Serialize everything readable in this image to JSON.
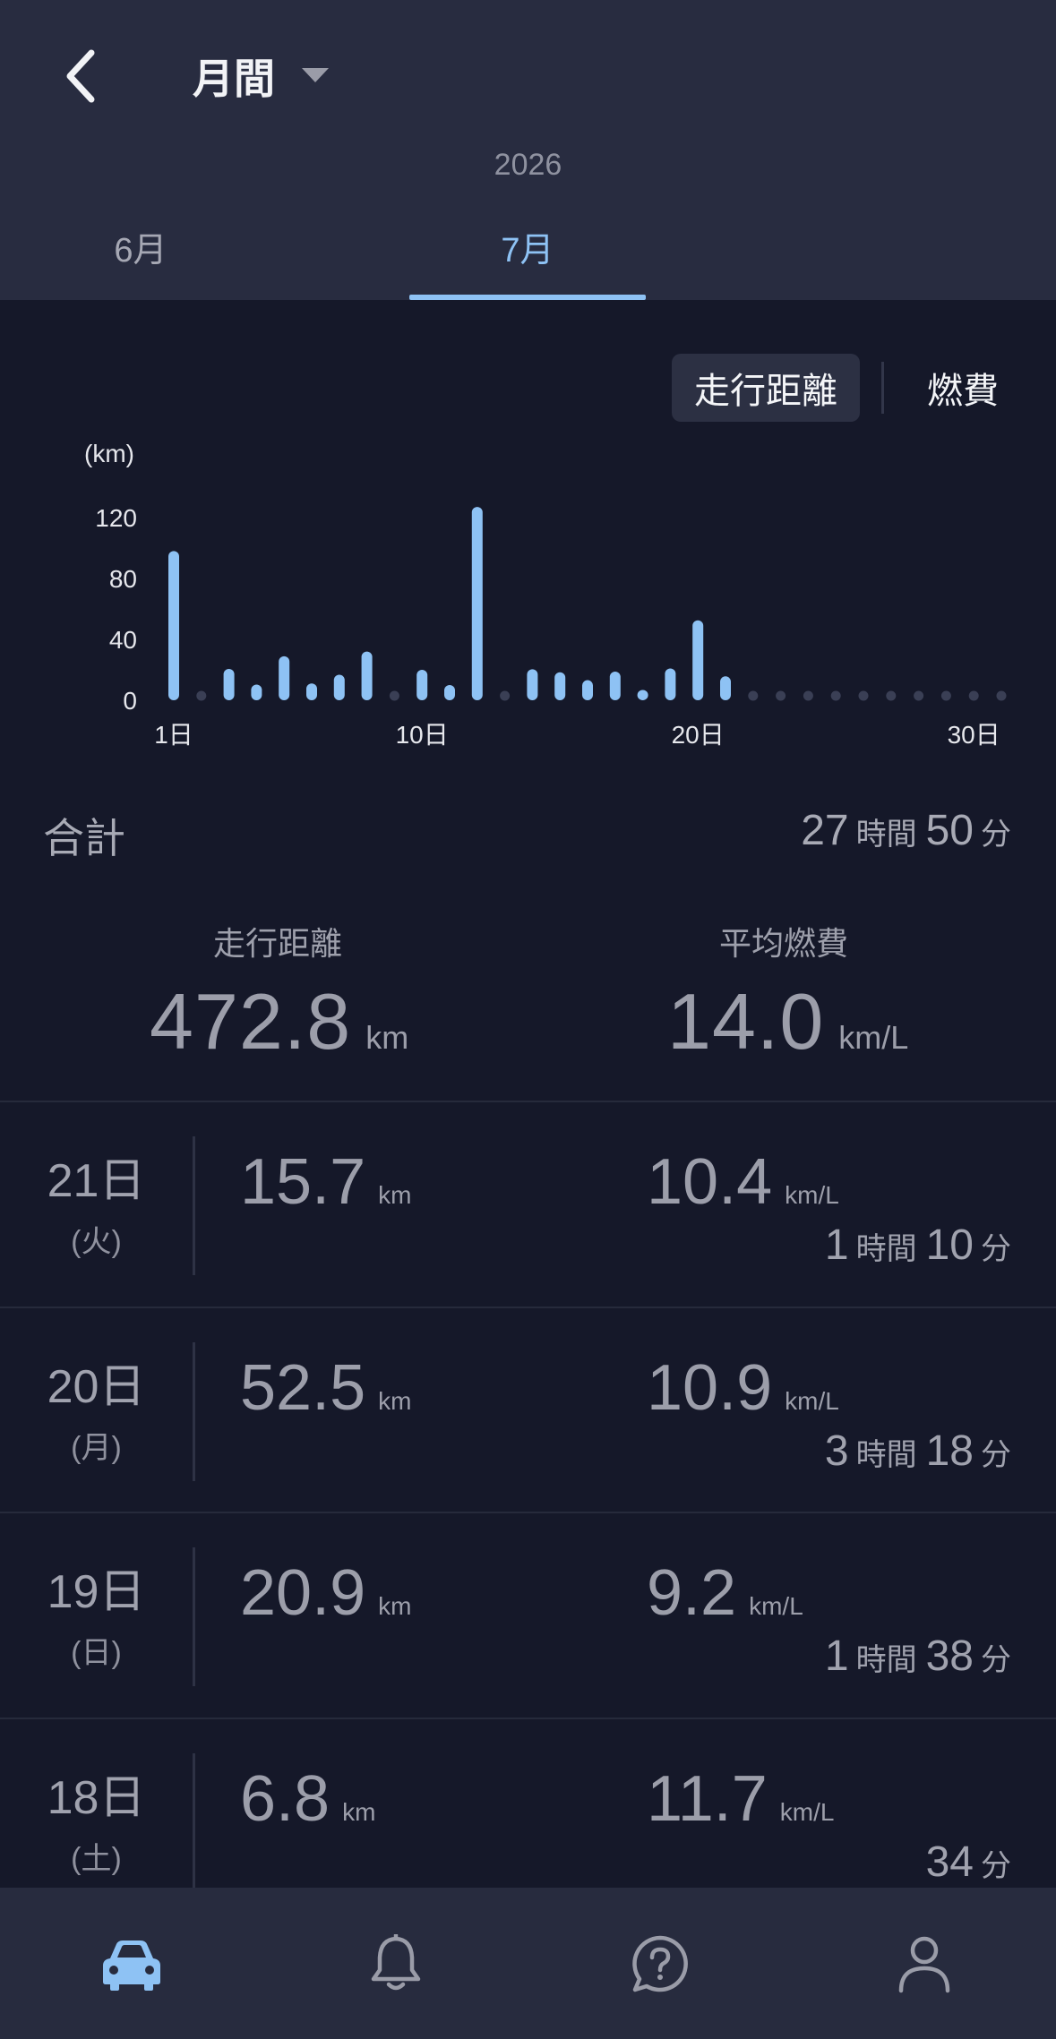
{
  "header": {
    "period_label": "月間",
    "year": "2026",
    "tabs": [
      {
        "label": "6月",
        "active": false
      },
      {
        "label": "7月",
        "active": true
      }
    ]
  },
  "toggle": {
    "distance_label": "走行距離",
    "efficiency_label": "燃費",
    "selected": "走行距離"
  },
  "chart_data": {
    "type": "bar",
    "y_unit_label": "(km)",
    "y_ticks": [
      "120",
      "80",
      "40",
      "0"
    ],
    "ylim": [
      0,
      130
    ],
    "x_tick_labels": [
      {
        "day": 1,
        "label": "1日"
      },
      {
        "day": 10,
        "label": "10日"
      },
      {
        "day": 20,
        "label": "20日"
      },
      {
        "day": 30,
        "label": "30日"
      }
    ],
    "days": [
      1,
      2,
      3,
      4,
      5,
      6,
      7,
      8,
      9,
      10,
      11,
      12,
      13,
      14,
      15,
      16,
      17,
      18,
      19,
      20,
      21,
      22,
      23,
      24,
      25,
      26,
      27,
      28,
      29,
      30,
      31
    ],
    "values": [
      98.0,
      0,
      20.6,
      10.3,
      28.9,
      11.0,
      16.8,
      32.0,
      0,
      20.0,
      10.0,
      127.0,
      0,
      20.4,
      18.4,
      13.2,
      18.8,
      6.8,
      20.9,
      52.5,
      15.7,
      0,
      0,
      0,
      0,
      0,
      0,
      0,
      0,
      0,
      0
    ],
    "bar_color": "#8ec2f4",
    "empty_marker_color": "#3a3f55"
  },
  "summary": {
    "total_label": "合計",
    "total_time": {
      "hours": "27",
      "hours_unit": "時間",
      "minutes": "50",
      "minutes_unit": "分"
    },
    "distance": {
      "label": "走行距離",
      "value": "472.8",
      "unit": "km"
    },
    "efficiency": {
      "label": "平均燃費",
      "value": "14.0",
      "unit": "km/L"
    }
  },
  "days": [
    {
      "day": "21日",
      "dow": "(火)",
      "distance": "15.7",
      "distance_unit": "km",
      "efficiency": "10.4",
      "efficiency_unit": "km/L",
      "hours": "1",
      "hours_unit": "時間",
      "minutes": "10",
      "minutes_unit": "分"
    },
    {
      "day": "20日",
      "dow": "(月)",
      "distance": "52.5",
      "distance_unit": "km",
      "efficiency": "10.9",
      "efficiency_unit": "km/L",
      "hours": "3",
      "hours_unit": "時間",
      "minutes": "18",
      "minutes_unit": "分"
    },
    {
      "day": "19日",
      "dow": "(日)",
      "distance": "20.9",
      "distance_unit": "km",
      "efficiency": "9.2",
      "efficiency_unit": "km/L",
      "hours": "1",
      "hours_unit": "時間",
      "minutes": "38",
      "minutes_unit": "分"
    },
    {
      "day": "18日",
      "dow": "(土)",
      "distance": "6.8",
      "distance_unit": "km",
      "efficiency": "11.7",
      "efficiency_unit": "km/L",
      "hours": null,
      "hours_unit": null,
      "minutes": "34",
      "minutes_unit": "分"
    }
  ],
  "nav": {
    "items": [
      {
        "icon": "car-icon",
        "active": true
      },
      {
        "icon": "bell-icon",
        "active": false
      },
      {
        "icon": "help-chat-icon",
        "active": false
      },
      {
        "icon": "profile-icon",
        "active": false
      }
    ],
    "active_color": "#8ec2f4",
    "inactive_color": "#9a9ca8"
  }
}
